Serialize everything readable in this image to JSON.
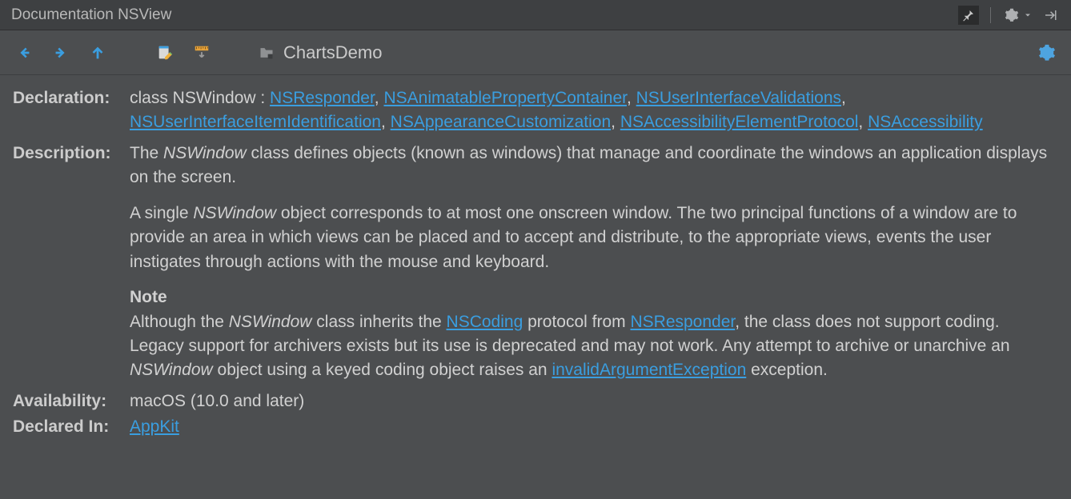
{
  "titlebar": {
    "title": "Documentation NSView"
  },
  "toolbar": {
    "breadcrumb": "ChartsDemo"
  },
  "doc": {
    "labels": {
      "declaration": "Declaration:",
      "description": "Description:",
      "availability": "Availability:",
      "declaredin": "Declared In:"
    },
    "declaration": {
      "prefix": "class NSWindow : ",
      "links": [
        "NSResponder",
        "NSAnimatablePropertyContainer",
        "NSUserInterfaceValidations",
        "NSUserInterfaceItemIdentification",
        "NSAppearanceCustomization",
        "NSAccessibilityElementProtocol",
        "NSAccessibility"
      ]
    },
    "description": {
      "p1_a": "The ",
      "p1_em": "NSWindow",
      "p1_b": " class defines objects (known as windows) that manage and coordinate the windows an application displays on the screen.",
      "p2_a": "A single ",
      "p2_em": "NSWindow",
      "p2_b": " object corresponds to at most one onscreen window. The two principal functions of a window are to provide an area in which views can be placed and to accept and distribute, to the appropriate views, events the user instigates through actions with the mouse and keyboard.",
      "note_heading": "Note",
      "p3_a": "Although the ",
      "p3_em1": "NSWindow",
      "p3_b": " class inherits the ",
      "p3_link1": "NSCoding",
      "p3_c": " protocol from ",
      "p3_link2": "NSResponder",
      "p3_d": ", the class does not support coding. Legacy support for archivers exists but its use is deprecated and may not work. Any attempt to archive or unarchive an ",
      "p3_em2": "NSWindow",
      "p3_e": " object using a keyed coding object raises an ",
      "p3_link3": "invalidArgumentException",
      "p3_f": " exception."
    },
    "availability": "macOS (10.0 and later)",
    "declaredin_link": "AppKit"
  }
}
